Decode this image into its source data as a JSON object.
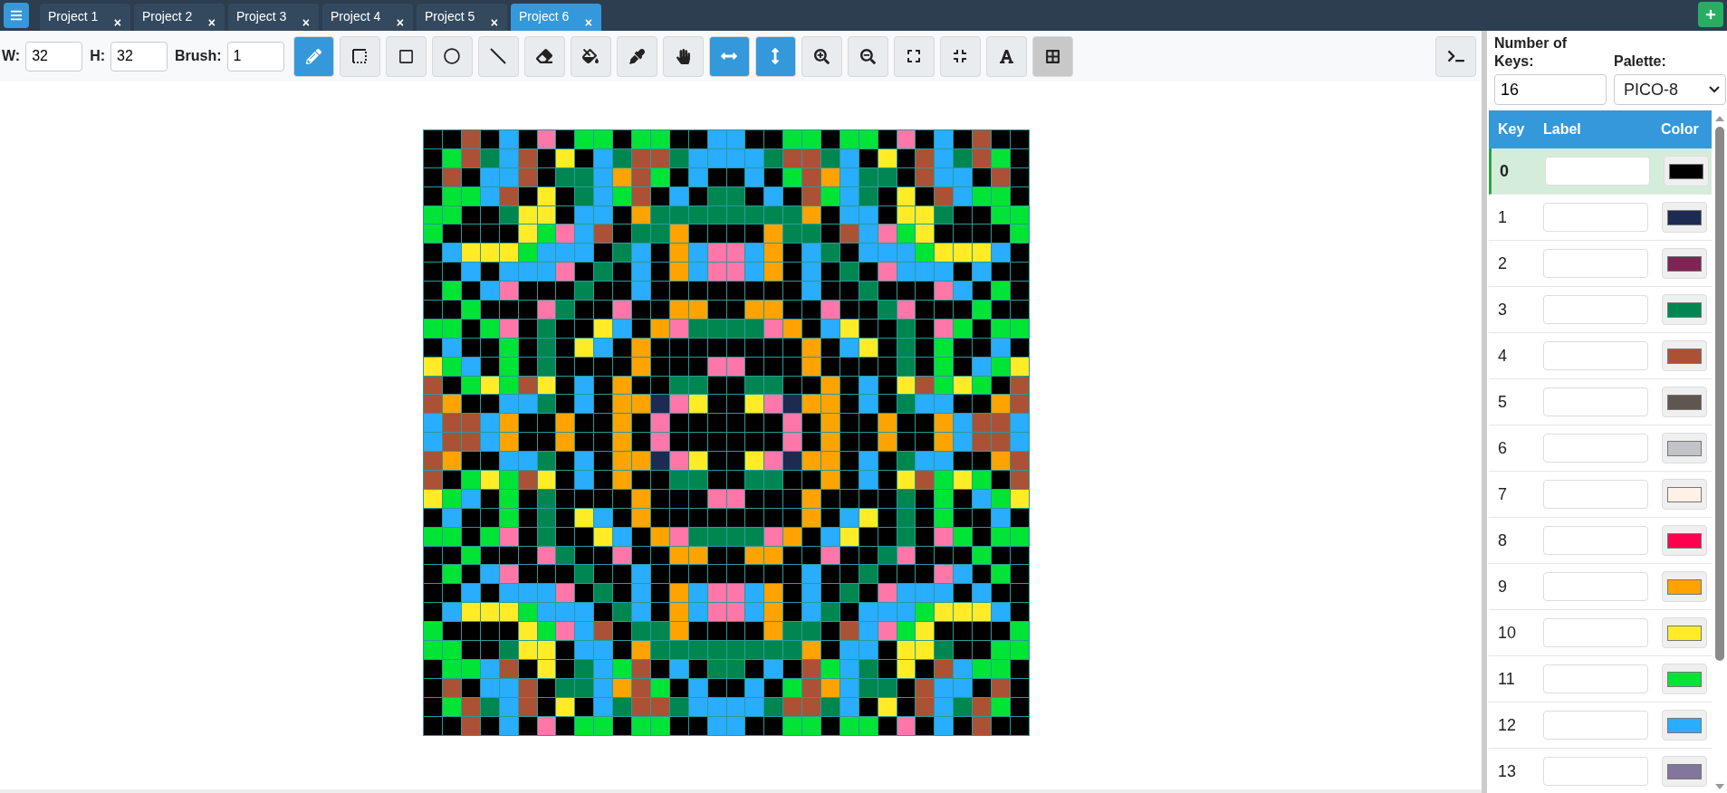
{
  "tabs": [
    {
      "label": "Project 1",
      "selected": false
    },
    {
      "label": "Project 2",
      "selected": false
    },
    {
      "label": "Project 3",
      "selected": false
    },
    {
      "label": "Project 4",
      "selected": false
    },
    {
      "label": "Project 5",
      "selected": false
    },
    {
      "label": "Project 6",
      "selected": true
    }
  ],
  "close_mark": "×",
  "toolbar": {
    "fields": [
      {
        "label": "W:",
        "value": "32"
      },
      {
        "label": "H:",
        "value": "32"
      },
      {
        "label": "Brush:",
        "value": "1"
      }
    ],
    "buttons": [
      {
        "kind": "pencil",
        "on": true
      },
      {
        "kind": "select",
        "on": false
      },
      {
        "kind": "rectangle",
        "on": false
      },
      {
        "kind": "circle",
        "on": false
      },
      {
        "kind": "line",
        "on": false
      },
      {
        "kind": "eraser",
        "on": false
      },
      {
        "kind": "fill",
        "on": false
      },
      {
        "kind": "picker",
        "on": false
      },
      {
        "kind": "hand",
        "on": false
      },
      {
        "kind": "flip-horizontal",
        "on": true
      },
      {
        "kind": "flip-vertical",
        "on": true
      },
      {
        "kind": "zoom-in",
        "on": false
      },
      {
        "kind": "zoom-out",
        "on": false
      },
      {
        "kind": "expand",
        "on": false
      },
      {
        "kind": "compress",
        "on": false
      },
      {
        "kind": "text",
        "on": false
      },
      {
        "kind": "grid",
        "on": true
      }
    ]
  },
  "panel": {
    "keys_label": "Number of Keys:",
    "keys_value": "16",
    "palette_label": "Palette:",
    "palette_value": "PICO-8",
    "columns": [
      "Key",
      "Label",
      "Color"
    ],
    "rows": [
      {
        "key": "0",
        "color": "#000000",
        "selected": true
      },
      {
        "key": "1",
        "color": "#1d2b53",
        "selected": false
      },
      {
        "key": "2",
        "color": "#7e2553",
        "selected": false
      },
      {
        "key": "3",
        "color": "#008751",
        "selected": false
      },
      {
        "key": "4",
        "color": "#ab5236",
        "selected": false
      },
      {
        "key": "5",
        "color": "#5f574f",
        "selected": false
      },
      {
        "key": "6",
        "color": "#c2c3c7",
        "selected": false
      },
      {
        "key": "7",
        "color": "#fff1e8",
        "selected": false
      },
      {
        "key": "8",
        "color": "#ff004d",
        "selected": false
      },
      {
        "key": "9",
        "color": "#ffa300",
        "selected": false
      },
      {
        "key": "10",
        "color": "#ffec27",
        "selected": false
      },
      {
        "key": "11",
        "color": "#00e436",
        "selected": false
      },
      {
        "key": "12",
        "color": "#29adff",
        "selected": false
      },
      {
        "key": "13",
        "color": "#83769c",
        "selected": false
      }
    ]
  }
}
